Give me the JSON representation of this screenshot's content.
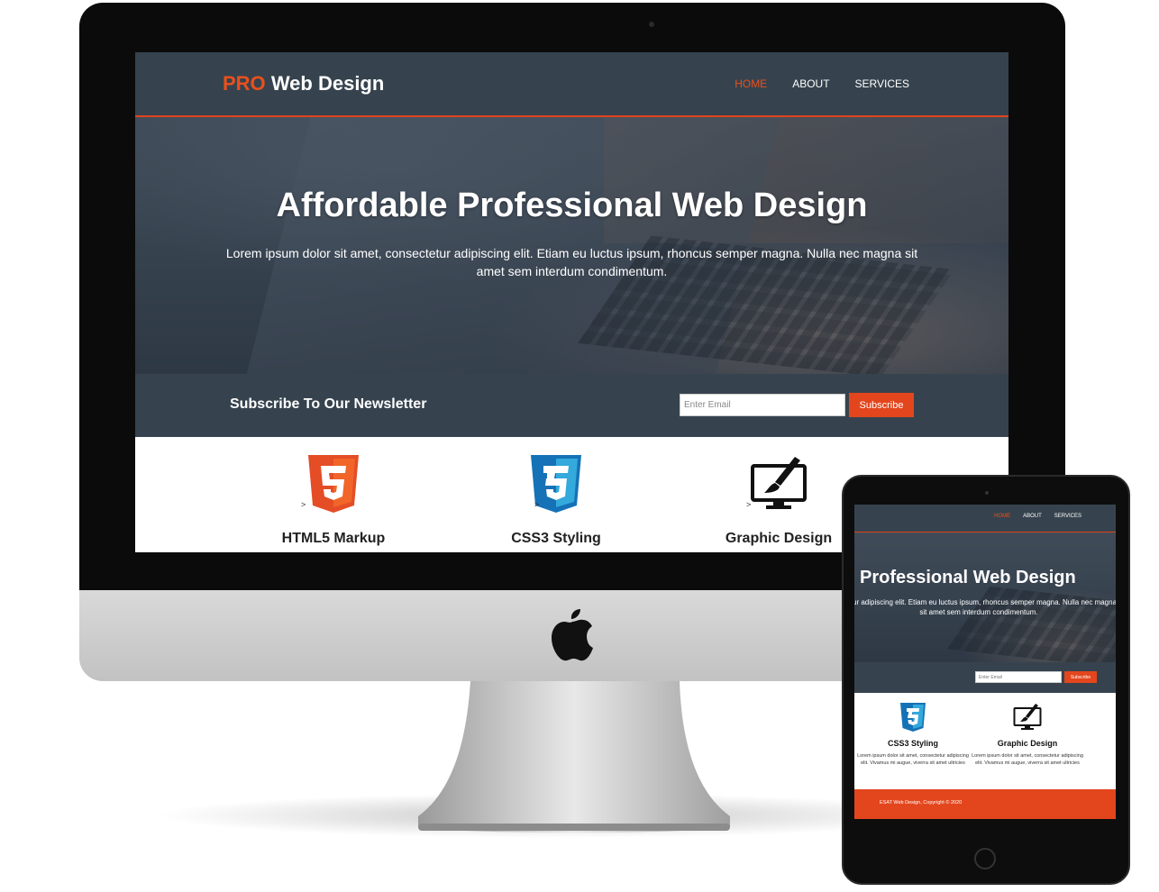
{
  "site": {
    "logo_highlight": "PRO",
    "logo_rest": "Web Design",
    "nav": [
      {
        "label": "HOME",
        "active": true
      },
      {
        "label": "ABOUT",
        "active": false
      },
      {
        "label": "SERVICES",
        "active": false
      }
    ],
    "hero": {
      "title": "Affordable Professional Web Design",
      "text": "Lorem ipsum dolor sit amet, consectetur adipiscing elit. Etiam eu luctus ipsum, rhoncus semper magna. Nulla nec magna sit amet sem interdum condimentum."
    },
    "newsletter": {
      "title": "Subscribe To Our Newsletter",
      "placeholder": "Enter Email",
      "button": "Subscribe"
    },
    "features": [
      {
        "title": "HTML5 Markup",
        "icon": "html5-icon",
        "arrow": ">"
      },
      {
        "title": "CSS3 Styling",
        "icon": "css3-icon",
        "arrow": ">"
      },
      {
        "title": "Graphic Design",
        "icon": "monitor-brush-icon",
        "arrow": ">"
      }
    ]
  },
  "tablet": {
    "hero_title": "Professional Web Design",
    "hero_text_line1": "ur adipiscing elit. Etiam eu luctus ipsum, rhoncus semper magna. Nulla nec magna",
    "hero_text_line2": "sit amet sem interdum condimentum.",
    "features": [
      {
        "title": "CSS3 Styling",
        "text": "Lorem ipsum dolor sit amet, consectetur adipiscing elit. Vivamus mi augue, viverra sit amet ultricies",
        "icon": "css3-icon"
      },
      {
        "title": "Graphic Design",
        "text": "Lorem ipsum dolor sit amet, consectetur adipiscing elit. Vivamus mi augue, viverra sit amet ultricies",
        "icon": "monitor-brush-icon"
      }
    ],
    "footer": "ESAT Web Design, Copyright © 2020"
  },
  "colors": {
    "accent": "#e3461d",
    "header_bg": "#36434e",
    "html5_orange": "#e44d26",
    "css3_blue": "#1572b6"
  },
  "devices": [
    "imac-icon",
    "ipad-icon",
    "apple-logo-icon"
  ]
}
